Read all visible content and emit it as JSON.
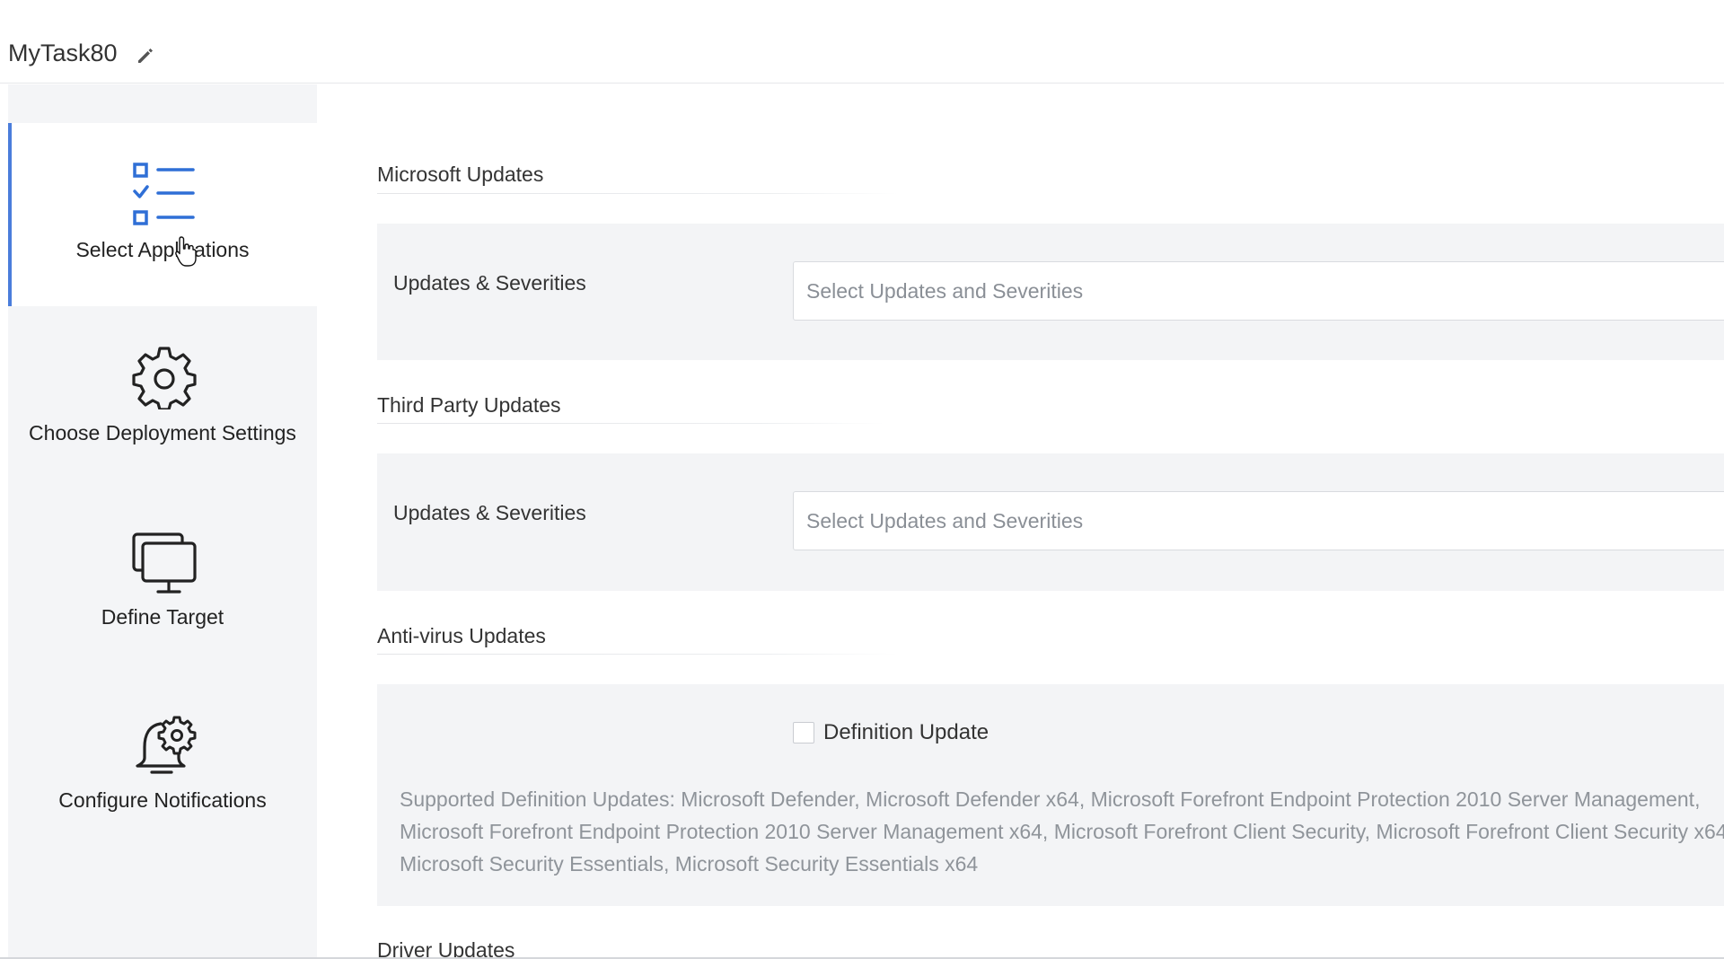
{
  "task": {
    "title": "MyTask80",
    "edit_icon": "pencil-icon"
  },
  "steps": [
    {
      "label": "Select Applications",
      "icon": "checklist-icon",
      "active": true
    },
    {
      "label": "Choose Deployment Settings",
      "icon": "gear-icon",
      "active": false
    },
    {
      "label": "Define Target",
      "icon": "monitor-icon",
      "active": false
    },
    {
      "label": "Configure Notifications",
      "icon": "bell-gear-icon",
      "active": false
    }
  ],
  "sections": {
    "microsoft": {
      "title": "Microsoft Updates",
      "field_label": "Updates & Severities",
      "placeholder": "Select Updates and Severities"
    },
    "third_party": {
      "title": "Third Party Updates",
      "field_label": "Updates & Severities",
      "placeholder": "Select Updates and Severities"
    },
    "antivirus": {
      "title": "Anti-virus Updates",
      "checkbox_label": "Definition Update",
      "checked": false,
      "note": "Supported Definition Updates: Microsoft Defender, Microsoft Defender x64, Microsoft Forefront Endpoint Protection 2010 Server Management, Microsoft Forefront Endpoint Protection 2010 Server Management x64, Microsoft Forefront Client Security, Microsoft Forefront Client Security x64, Microsoft Security Essentials, Microsoft Security Essentials x64"
    },
    "driver": {
      "title": "Driver Updates"
    }
  },
  "colors": {
    "accent": "#4a7ddb",
    "icon_blue": "#2f6fd6",
    "sidebar_bg": "#f4f5f7",
    "panel_bg": "#f3f4f6"
  }
}
